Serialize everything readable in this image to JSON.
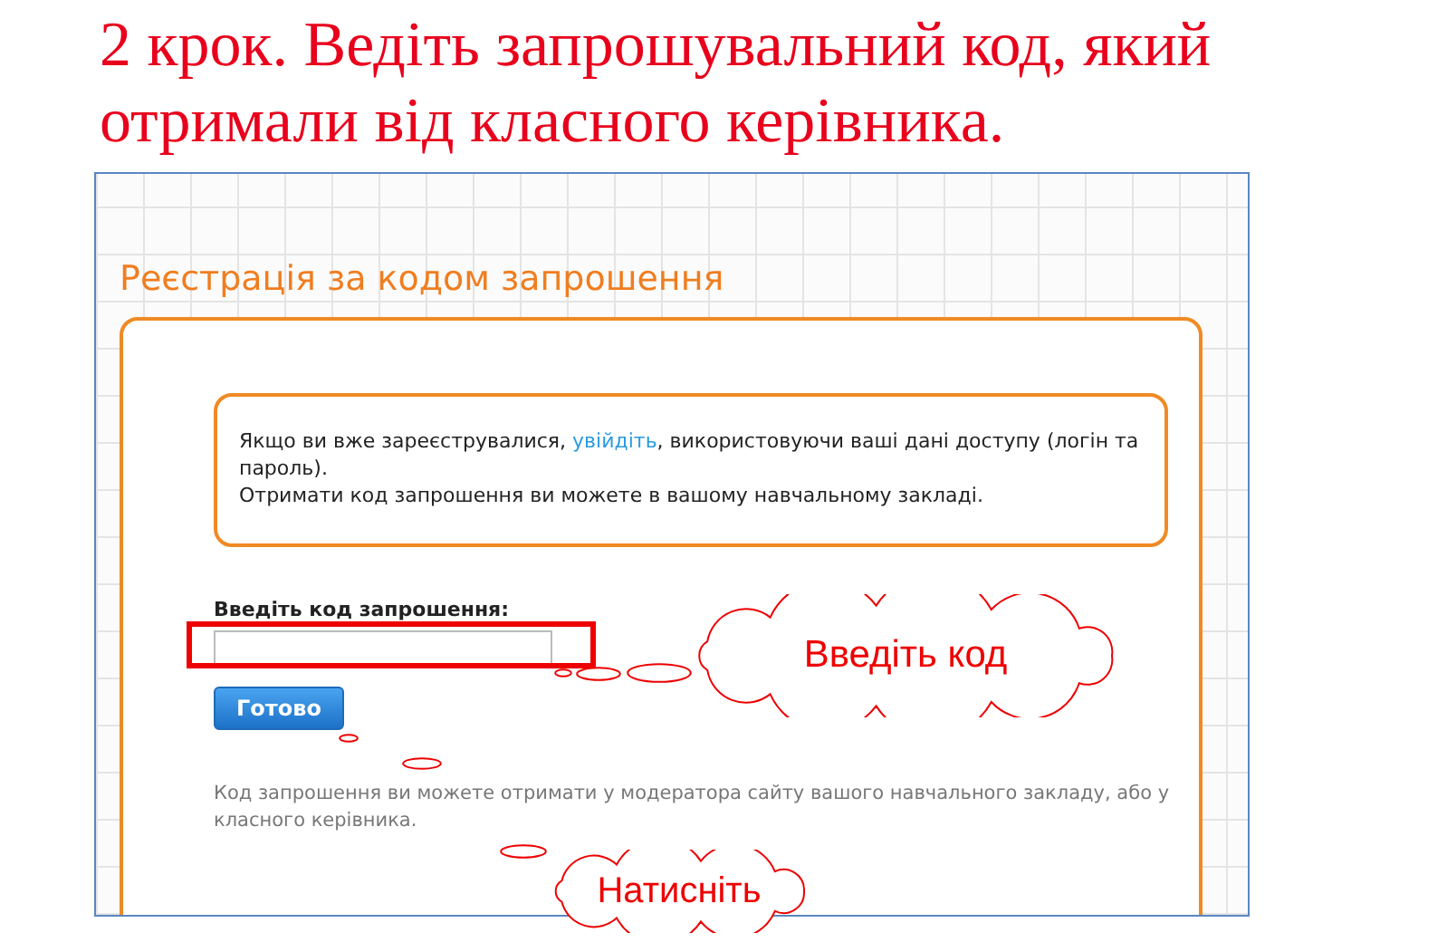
{
  "slide_title": "2 крок. Ведіть запрошувальний код, який отримали від класного керівника.",
  "screenshot": {
    "heading": "Реєстрація за кодом запрошення",
    "notice": {
      "text_before": "Якщо ви вже зареєструвалися, ",
      "link": "увійдіть",
      "text_after": ", використовуючи ваші дані доступу (логін та пароль).",
      "line2": "Отримати код запрошення ви можете в вашому навчальному закладі."
    },
    "code_label": "Введіть код запрошення:",
    "code_input": {
      "highlighted": true
    },
    "submit_button": "Готово",
    "hint": "Код запрошення ви можете отримати у модератора сайту вашого навчального закладу, або у класного керівника."
  },
  "callouts": [
    {
      "kind": "input",
      "text": "Введіть код"
    },
    {
      "kind": "button",
      "text": "Натисніть"
    }
  ]
}
